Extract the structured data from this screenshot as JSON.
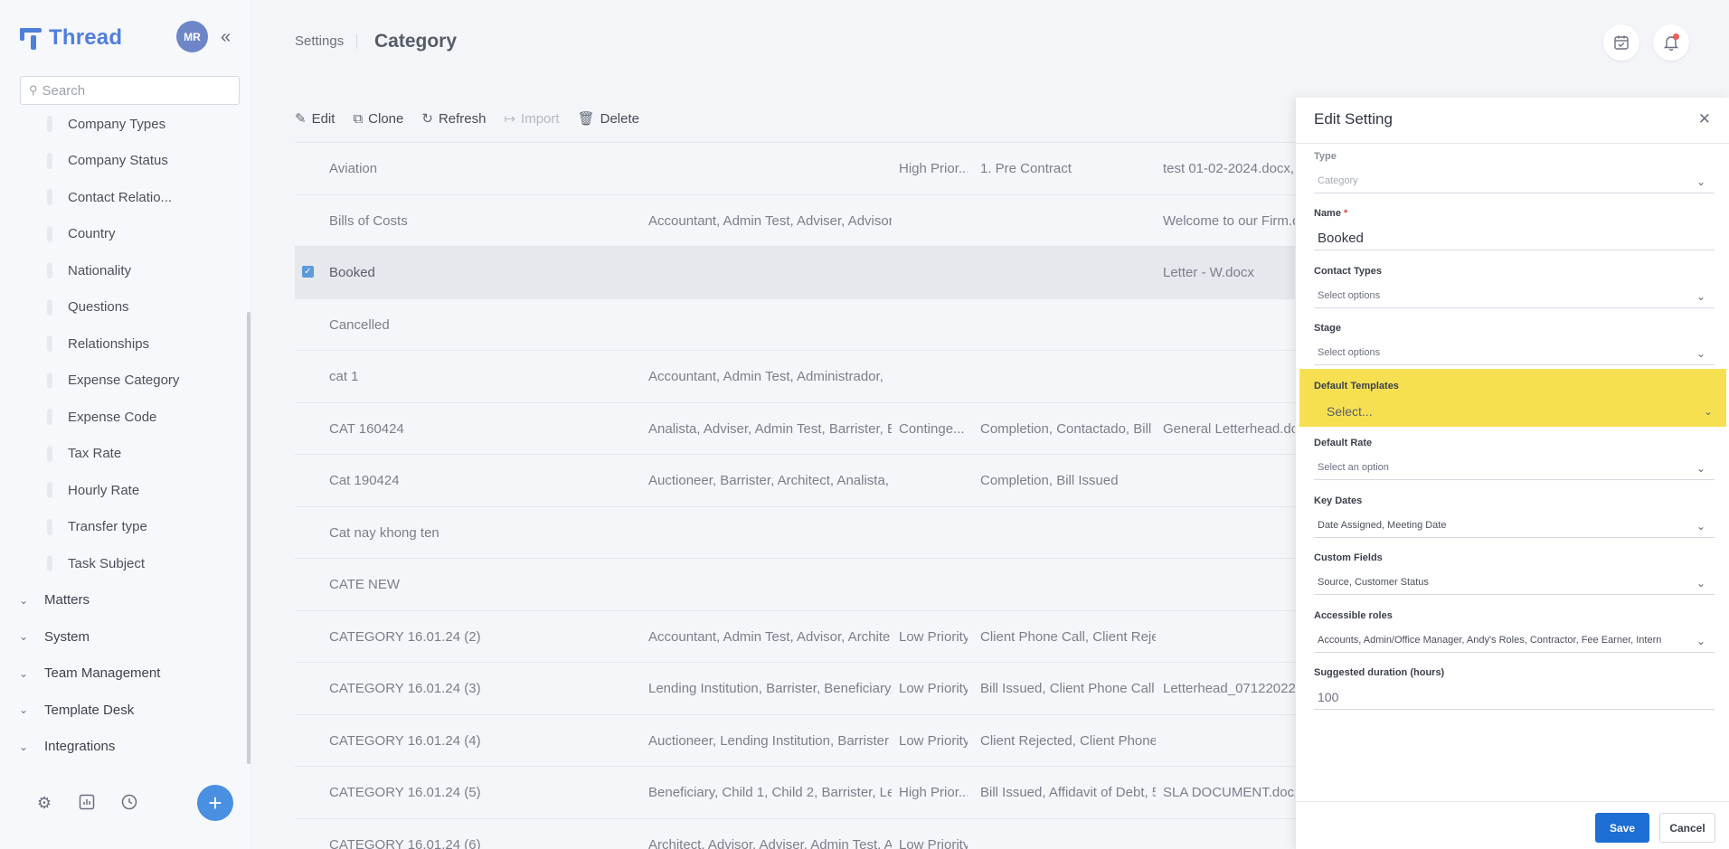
{
  "app": {
    "logo_text": "Thread",
    "user_initials": "MR",
    "brand_color": "#4f7fd9"
  },
  "search": {
    "placeholder": "Search"
  },
  "sidebar": {
    "sub_items": [
      "Company Types",
      "Company Status",
      "Contact Relatio...",
      "Country",
      "Nationality",
      "Questions",
      "Relationships",
      "Expense Category",
      "Expense Code",
      "Tax Rate",
      "Hourly Rate",
      "Transfer type",
      "Task Subject"
    ],
    "groups": [
      "Matters",
      "System",
      "Team Management",
      "Template Desk",
      "Integrations"
    ]
  },
  "header": {
    "breadcrumb": "Settings",
    "title": "Category"
  },
  "toolbar": {
    "edit": "Edit",
    "clone": "Clone",
    "refresh": "Refresh",
    "import": "Import",
    "delete": "Delete"
  },
  "table": {
    "rows": [
      {
        "name": "Aviation",
        "roles": "",
        "priority": "High Prior...",
        "stage": "1. Pre Contract",
        "template": "test 01-02-2024.docx,"
      },
      {
        "name": "Bills of Costs",
        "roles": "Accountant, Admin Test, Adviser, Advisor",
        "priority": "",
        "stage": "",
        "template": "Welcome to our Firm.d"
      },
      {
        "name": "Booked",
        "roles": "",
        "priority": "",
        "stage": "",
        "template": "Letter - W.docx",
        "selected": true
      },
      {
        "name": "Cancelled",
        "roles": "",
        "priority": "",
        "stage": "",
        "template": ""
      },
      {
        "name": "cat 1",
        "roles": "Accountant, Admin Test, Administrador,",
        "priority": "",
        "stage": "",
        "template": ""
      },
      {
        "name": "CAT 160424",
        "roles": "Analista, Adviser, Admin Test, Barrister, B",
        "priority": "Continge...",
        "stage": "Completion, Contactado, Bill",
        "template": "General Letterhead.do"
      },
      {
        "name": "Cat 190424",
        "roles": "Auctioneer, Barrister, Architect, Analista,",
        "priority": "",
        "stage": "Completion, Bill Issued",
        "template": ""
      },
      {
        "name": "Cat nay khong ten",
        "roles": "",
        "priority": "",
        "stage": "",
        "template": ""
      },
      {
        "name": "CATE NEW",
        "roles": "",
        "priority": "",
        "stage": "",
        "template": ""
      },
      {
        "name": "CATEGORY 16.01.24 (2)",
        "roles": "Accountant, Admin Test, Advisor, Archite",
        "priority": "Low Priority",
        "stage": "Client Phone Call, Client Reje",
        "template": ""
      },
      {
        "name": "CATEGORY 16.01.24 (3)",
        "roles": "Lending Institution, Barrister, Beneficiary,",
        "priority": "Low Priority",
        "stage": "Bill Issued, Client Phone Call,",
        "template": "Letterhead_07122022("
      },
      {
        "name": "CATEGORY 16.01.24 (4)",
        "roles": "Auctioneer, Lending Institution, Barrister",
        "priority": "Low Priority",
        "stage": "Client Rejected, Client Phone",
        "template": ""
      },
      {
        "name": "CATEGORY 16.01.24 (5)",
        "roles": "Beneficiary, Child 1, Child 2, Barrister, Len",
        "priority": "High Prior...",
        "stage": "Bill Issued, Affidavit of Debt, 5",
        "template": "SLA DOCUMENT.docx,"
      },
      {
        "name": "CATEGORY 16.01.24 (6)",
        "roles": "Architect, Advisor, Adviser, Admin Test, A",
        "priority": "Low Priority",
        "stage": "",
        "template": ""
      }
    ]
  },
  "drawer": {
    "title": "Edit Setting",
    "fields": {
      "type": {
        "label": "Type",
        "value": "Category"
      },
      "name": {
        "label": "Name",
        "required_mark": "*",
        "value": "Booked"
      },
      "contact_types": {
        "label": "Contact Types",
        "value": "Select options"
      },
      "stage": {
        "label": "Stage",
        "value": "Select options"
      },
      "default_templates": {
        "label": "Default Templates",
        "value": "Select...",
        "highlight_color": "#f6e052"
      },
      "default_rate": {
        "label": "Default Rate",
        "value": "Select an option"
      },
      "key_dates": {
        "label": "Key Dates",
        "value": "Date Assigned, Meeting Date"
      },
      "custom_fields": {
        "label": "Custom Fields",
        "value": "Source, Customer Status"
      },
      "accessible_roles": {
        "label": "Accessible roles",
        "value": "Accounts, Admin/Office Manager, Andy's Roles, Contractor, Fee Earner, Intern"
      },
      "suggested_duration": {
        "label": "Suggested duration (hours)",
        "value": "100"
      }
    },
    "save": "Save",
    "cancel": "Cancel"
  }
}
